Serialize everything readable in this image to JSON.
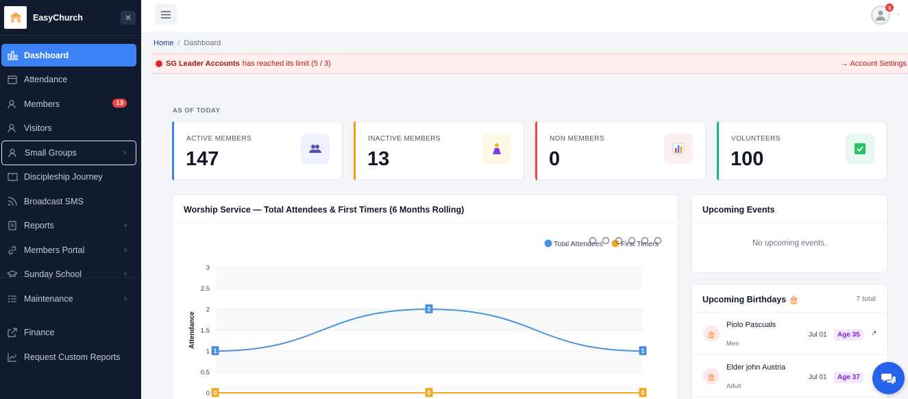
{
  "brand": {
    "name": "EasyChurch",
    "close_glyph": "✕"
  },
  "sidebar": {
    "items": [
      {
        "label": "Dashboard",
        "icon": "chart-bars-icon",
        "active": true
      },
      {
        "label": "Attendance",
        "icon": "calendar-icon"
      },
      {
        "label": "Members",
        "icon": "users-icon",
        "badge": "13"
      },
      {
        "label": "Visitors",
        "icon": "user-icon"
      },
      {
        "label": "Small Groups",
        "icon": "group-icon",
        "chevron": "›"
      },
      {
        "label": "Discipleship Journey",
        "icon": "book-icon"
      },
      {
        "label": "Broadcast SMS",
        "icon": "broadcast-icon"
      },
      {
        "label": "Reports",
        "icon": "report-icon",
        "chevron": "›"
      },
      {
        "label": "Members Portal",
        "icon": "link-icon",
        "chevron": "›"
      },
      {
        "label": "Sunday School",
        "icon": "graduation-cap-icon",
        "chevron": "›"
      },
      {
        "label": "Maintenance",
        "icon": "list-icon",
        "chevron": "›"
      },
      {
        "label": "Finance",
        "icon": "external-link-icon"
      },
      {
        "label": "Request Custom Reports",
        "icon": "trend-chart-icon"
      }
    ]
  },
  "topbar": {
    "notification_count": "3",
    "caret": "⌄"
  },
  "breadcrumb": {
    "home": "Home",
    "separator": "/",
    "current": "Dashboard"
  },
  "alert": {
    "strong": "SG Leader Accounts",
    "message": "has reached its limit (5 / 3)",
    "link": "→ Account Settings"
  },
  "as_of": "AS OF TODAY",
  "stats": [
    {
      "label": "ACTIVE MEMBERS",
      "value": "147",
      "accent": "#3b82f6",
      "icon_bg": "#eef2ff",
      "icon": "users-icon"
    },
    {
      "label": "INACTIVE MEMBERS",
      "value": "13",
      "accent": "#f59e0b",
      "icon_bg": "#fef9e7",
      "icon": "person-icon"
    },
    {
      "label": "NON MEMBERS",
      "value": "0",
      "accent": "#ef4444",
      "icon_bg": "#fdeef0",
      "icon": "bar-chart-icon"
    },
    {
      "label": "VOLUNTEERS",
      "value": "100",
      "accent": "#10b981",
      "icon_bg": "#e8f8f0",
      "icon": "check-icon"
    }
  ],
  "chart_panel": {
    "title": "Worship Service — Total Attendees & First Timers (6 Months Rolling)"
  },
  "chart_data": {
    "type": "line",
    "ylabel": "Attendance",
    "ylim": [
      0,
      3
    ],
    "yticks": [
      "0",
      "0.5",
      "1",
      "1.5",
      "2",
      "2.5",
      "3"
    ],
    "series": [
      {
        "name": "Total Attendees",
        "color": "#4a90e2",
        "values": [
          1,
          2,
          1
        ]
      },
      {
        "name": "First Timers",
        "color": "#f5a623",
        "values": [
          0,
          0,
          0
        ]
      }
    ],
    "legend_position": "top-right"
  },
  "events": {
    "title": "Upcoming Events",
    "empty": "No upcoming events."
  },
  "birthdays": {
    "title": "Upcoming Birthdays 🎂",
    "total": "7 total",
    "rows": [
      {
        "name": "Piolo Pascuals",
        "group": "Men",
        "date": "Jul 01",
        "age": "Age 35",
        "link": "↗"
      },
      {
        "name": "Elder john Austria",
        "group": "Adult",
        "date": "Jul 01",
        "age": "Age 37"
      }
    ]
  }
}
